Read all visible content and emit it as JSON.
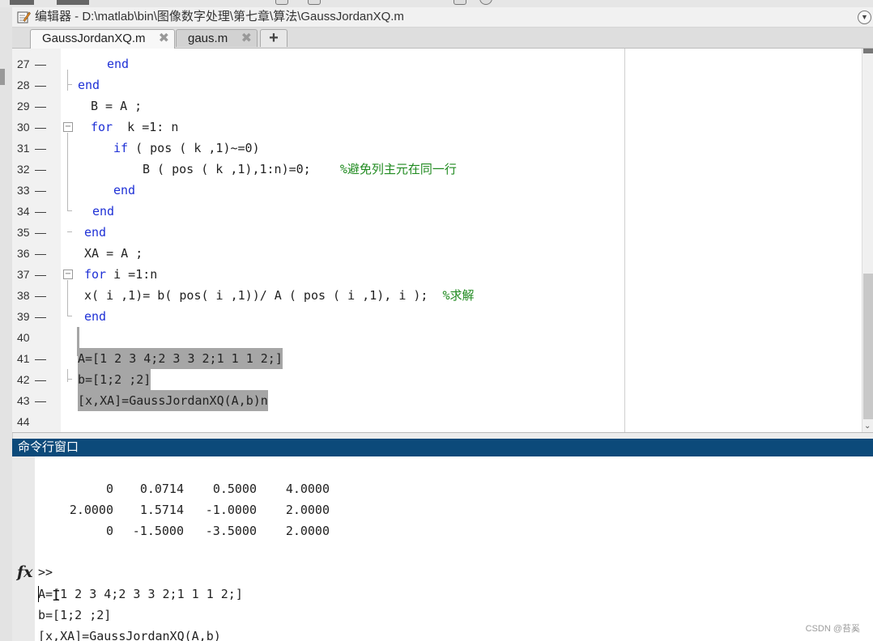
{
  "window": {
    "title": "编辑器 - D:\\matlab\\bin\\图像数字处理\\第七章\\算法\\GaussJordanXQ.m"
  },
  "tabs": [
    {
      "label": "GaussJordanXQ.m",
      "close": "✖"
    },
    {
      "label": "gaus.m",
      "close": "✖"
    }
  ],
  "add_tab_label": "+",
  "editor_lines": [
    {
      "num": "27",
      "dash": "—",
      "code": "end",
      "type": "kw"
    },
    {
      "num": "28",
      "dash": "—",
      "code": "end",
      "type": "kw"
    },
    {
      "num": "29",
      "dash": "—",
      "code": "B = A ;",
      "type": "plain"
    },
    {
      "num": "30",
      "dash": "—",
      "kw": "for",
      "rest": "  k =1: n"
    },
    {
      "num": "31",
      "dash": "—",
      "kw": "if",
      "rest": " ( pos ( k ,1)~=0)"
    },
    {
      "num": "32",
      "dash": "—",
      "code": "B ( pos ( k ,1),1:n)=0;    ",
      "comment": "%避免列主元在同一行"
    },
    {
      "num": "33",
      "dash": "—",
      "code": "end",
      "type": "kw"
    },
    {
      "num": "34",
      "dash": "—",
      "code": "end",
      "type": "kw"
    },
    {
      "num": "35",
      "dash": "—",
      "code": "end",
      "type": "kw"
    },
    {
      "num": "36",
      "dash": "—",
      "code": "XA = A ;",
      "type": "plain"
    },
    {
      "num": "37",
      "dash": "—",
      "kw": "for",
      "rest": " i =1:n"
    },
    {
      "num": "38",
      "dash": "—",
      "code": "x( i ,1)= b( pos( i ,1))/ A ( pos ( i ,1), i );  ",
      "comment": "%求解"
    },
    {
      "num": "39",
      "dash": "—",
      "code": "end",
      "type": "kw"
    },
    {
      "num": "40",
      "dash": "",
      "code": "",
      "type": "plain"
    },
    {
      "num": "41",
      "dash": "—",
      "code": "A=[1 2 3 4;2 3 3 2;1 1 1 2;]",
      "type": "hl"
    },
    {
      "num": "42",
      "dash": "—",
      "code": "b=[1;2 ;2]",
      "type": "hl"
    },
    {
      "num": "43",
      "dash": "—",
      "code": "[x,XA]=GaussJordanXQ(A,b)n",
      "type": "hl"
    },
    {
      "num": "44",
      "dash": "",
      "code": "",
      "type": "plain"
    }
  ],
  "command_window": {
    "title": "命令行窗口",
    "matrix": [
      [
        "0",
        "0.0714",
        "0.5000",
        "4.0000"
      ],
      [
        "2.0000",
        "1.5714",
        "-1.0000",
        "2.0000"
      ],
      [
        "0",
        "-1.5000",
        "-3.5000",
        "2.0000"
      ]
    ],
    "prompt": ">>",
    "fx_label": "fx",
    "typed_lines": [
      "A=[1 2 3 4;2 3 3 2;1 1 1 2;]",
      "b=[1;2 ;2]",
      "[x,XA]=GaussJordanXQ(A,b)"
    ]
  },
  "watermark": "CSDN @苔奚"
}
